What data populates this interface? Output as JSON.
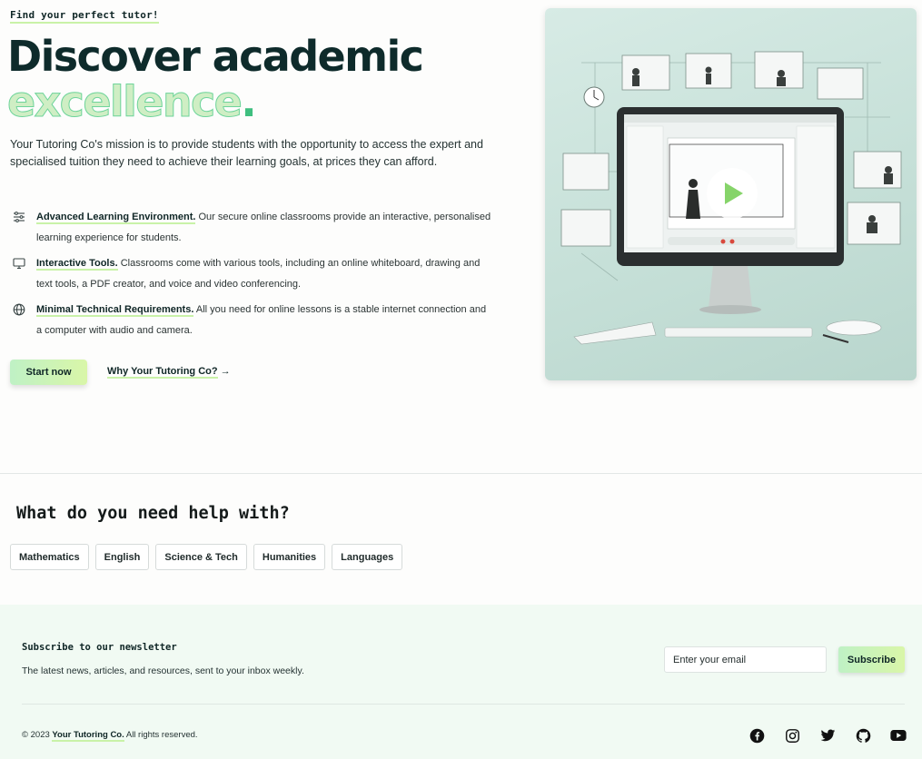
{
  "hero": {
    "eyebrow": "Find your perfect tutor!",
    "title_line1": "Discover academic",
    "title_accent": "excellence",
    "title_dot": ".",
    "intro": "Your Tutoring Co's mission is to provide students with the opportunity to access the expert and specialised tuition they need to achieve their learning goals, at prices they can afford.",
    "features": [
      {
        "icon": "sliders-icon",
        "title": "Advanced Learning Environment.",
        "text": " Our secure online classrooms provide an interactive, personalised learning experience for students."
      },
      {
        "icon": "monitor-icon",
        "title": "Interactive Tools.",
        "text": " Classrooms come with various tools, including an online whiteboard, drawing and text tools, a PDF creator, and voice and video conferencing."
      },
      {
        "icon": "globe-icon",
        "title": "Minimal Technical Requirements.",
        "text": " All you need for online lessons is a stable internet connection and a computer with audio and camera."
      }
    ],
    "start_button": "Start now",
    "why_link": "Why Your Tutoring Co?",
    "why_arrow": "→",
    "colors": {
      "accent": "#c9f2a8",
      "dark": "#0e2b2b"
    }
  },
  "help": {
    "title": "What do you need help with?",
    "subjects": [
      "Mathematics",
      "English",
      "Science & Tech",
      "Humanities",
      "Languages"
    ]
  },
  "footer": {
    "newsletter_title": "Subscribe to our newsletter",
    "newsletter_desc": "The latest news, articles, and resources, sent to your inbox weekly.",
    "email_placeholder": "Enter your email",
    "subscribe_button": "Subscribe",
    "copyright_prefix": "© 2023 ",
    "copyright_brand": "Your Tutoring Co.",
    "copyright_suffix": " All rights reserved.",
    "socials": [
      "facebook-icon",
      "instagram-icon",
      "twitter-icon",
      "github-icon",
      "youtube-icon"
    ]
  }
}
